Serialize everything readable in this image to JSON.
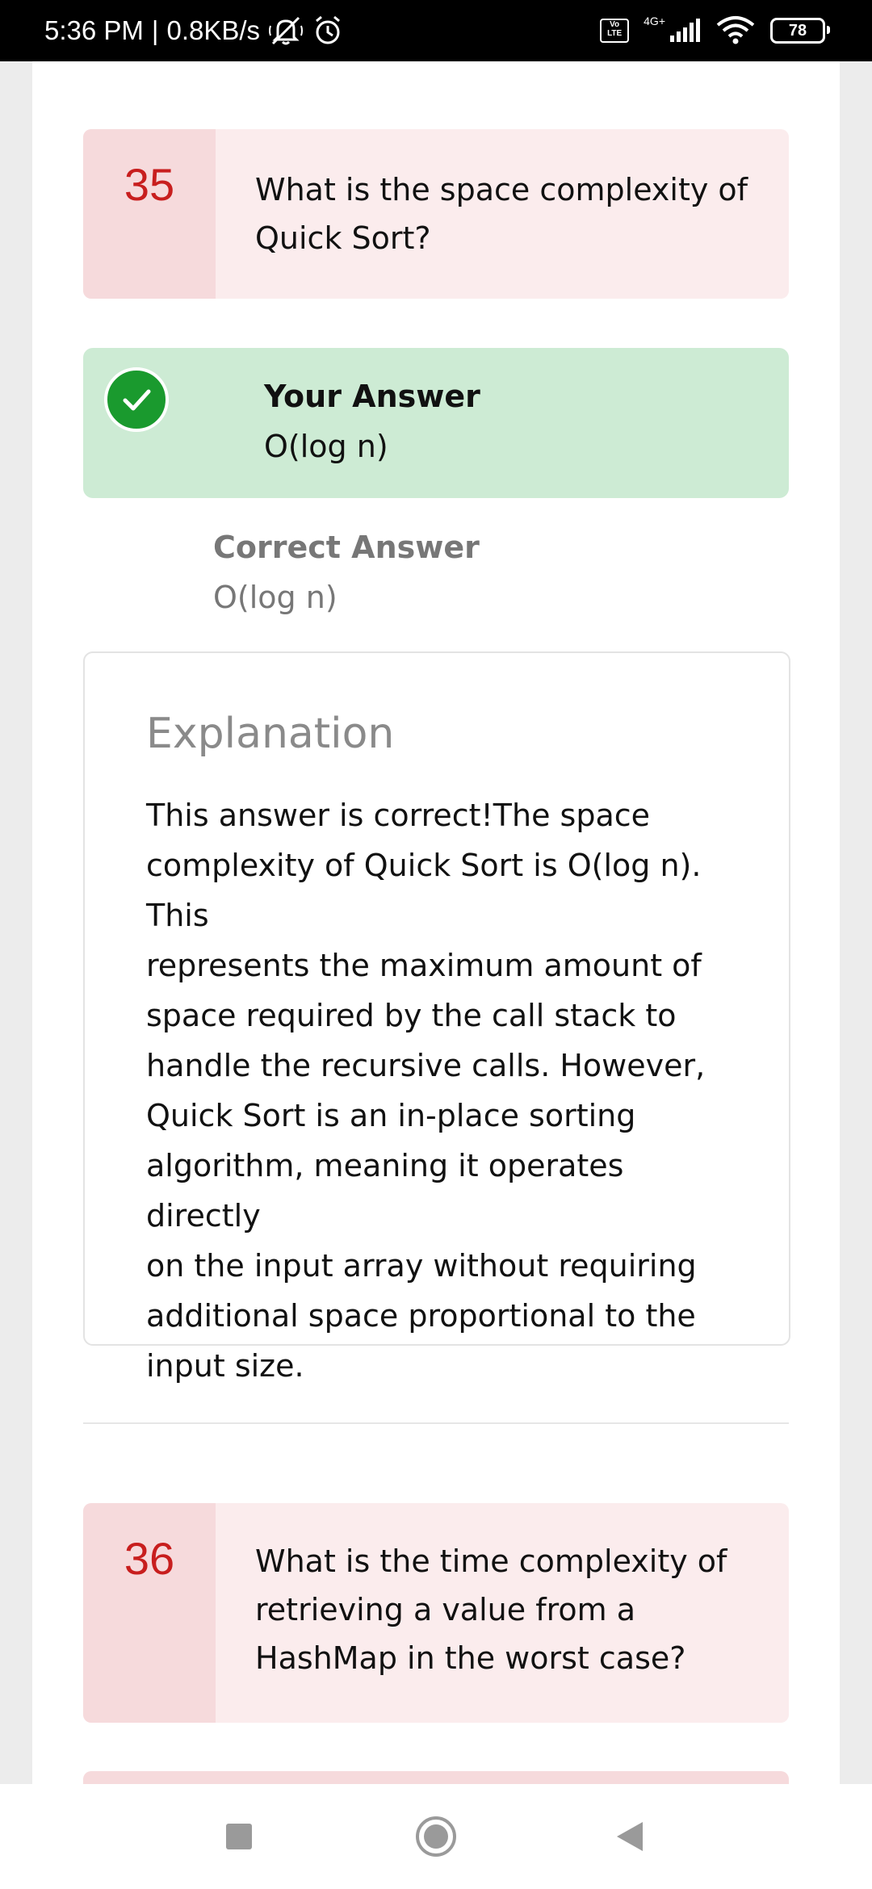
{
  "status_bar": {
    "time": "5:36 PM",
    "separator": "|",
    "speed": "0.8KB/s",
    "volte_label": "Vo LTE",
    "network_type": "4G+",
    "battery": "78",
    "icons": [
      "mute-icon",
      "alarm-icon",
      "signal-icon",
      "wifi-icon",
      "battery-icon"
    ]
  },
  "question_35": {
    "number": "35",
    "text_line1": "What is the space complexity of",
    "text_line2": "Quick Sort?"
  },
  "your_answer": {
    "label": "Your Answer",
    "value": "O(log n)"
  },
  "correct_answer": {
    "label": "Correct Answer",
    "value": "O(log n)"
  },
  "explanation": {
    "title": "Explanation",
    "lines": [
      "This answer is correct!The space",
      "complexity of Quick Sort is O(log n). This",
      "represents the maximum amount of",
      "space required by the call stack to",
      "handle the recursive calls. However,",
      "Quick Sort is an in-place sorting",
      "algorithm, meaning it operates directly",
      "on the input array without requiring",
      "additional space proportional to the",
      "input size."
    ]
  },
  "question_36": {
    "number": "36",
    "text_line1": "What is the time complexity of",
    "text_line2": "retrieving a value from a",
    "text_line3": "HashMap in the worst case?"
  },
  "colors": {
    "question_bg": "#fbeced",
    "question_number_bg": "#f6dadc",
    "question_number": "#c81e1e",
    "correct_bg": "#cdebd4",
    "check_green": "#1a9a2e"
  },
  "nav_bar": {
    "icons": [
      "recents-square-icon",
      "home-circle-icon",
      "back-triangle-icon"
    ]
  }
}
